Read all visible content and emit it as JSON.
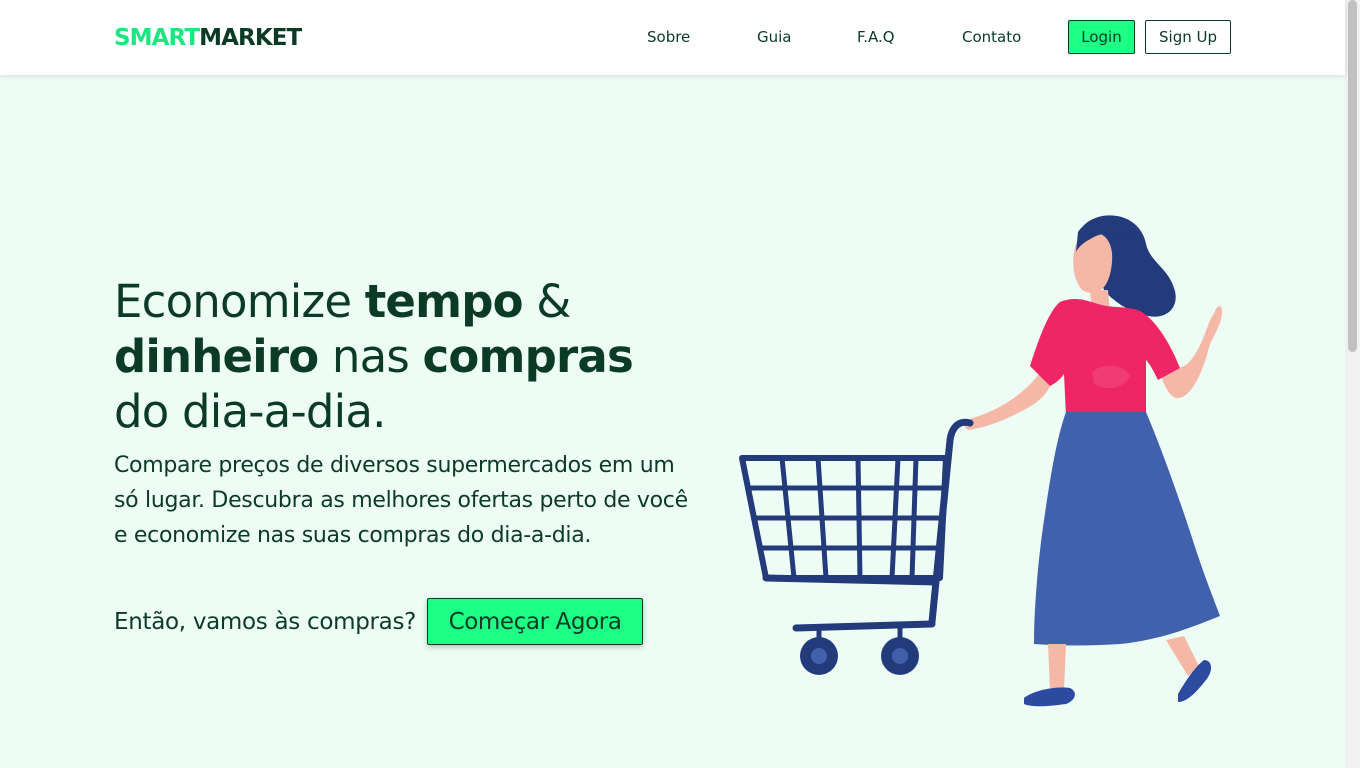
{
  "brand": {
    "part1": "SMART",
    "part2": "MARKET"
  },
  "nav": {
    "links": [
      "Sobre",
      "Guia",
      "F.A.Q",
      "Contato"
    ],
    "login": "Login",
    "signup": "Sign Up"
  },
  "hero": {
    "h_1": "Economize ",
    "h_2": "tempo",
    "h_3": " &",
    "h_4": "dinheiro",
    "h_5": " nas ",
    "h_6": "compras",
    "h_7": "do dia-a-dia.",
    "description": "Compare preços de diversos supermercados em um só lugar. Descubra as melhores ofertas perto de você e economize nas suas compras do dia-a-dia.",
    "cta_question": "Então, vamos às compras?",
    "cta_button": "Começar Agora"
  },
  "illustration": {
    "icon": "woman-with-shopping-cart-illustration"
  },
  "colors": {
    "brand_green": "#1de580",
    "button_green": "#1dff85",
    "dark_green": "#0b3b24",
    "page_background": "#edfdf5"
  }
}
